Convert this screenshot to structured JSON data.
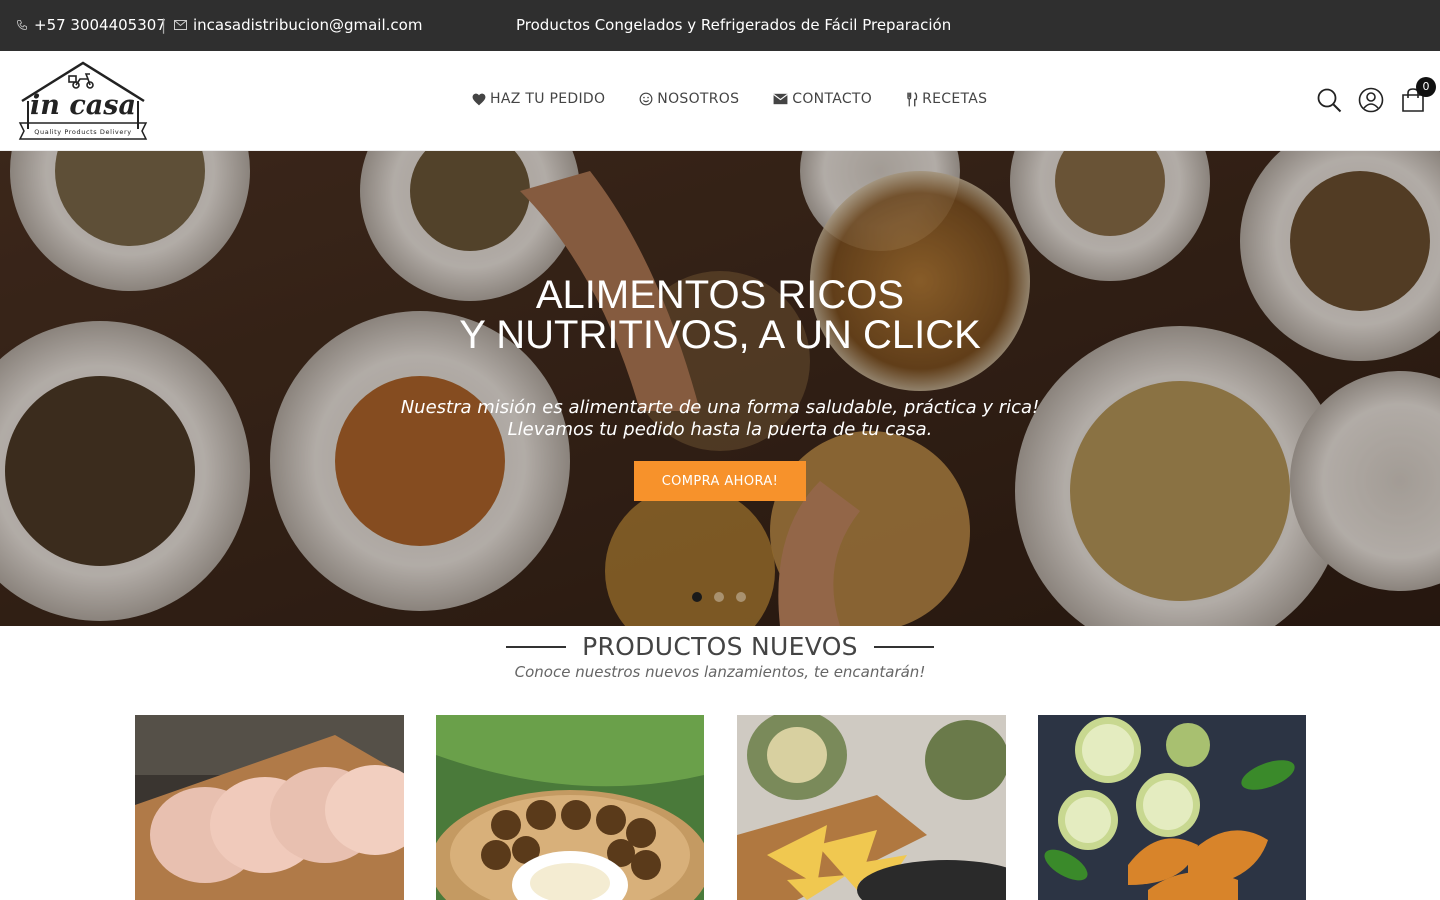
{
  "topbar": {
    "phone": "+57 3004405307",
    "separator": "|",
    "email": "incasadistribucion@gmail.com",
    "tagline": "Productos Congelados y Refrigerados de Fácil Preparación",
    "phone_icon": "phone-icon",
    "email_icon": "envelope-icon"
  },
  "header": {
    "logo": {
      "brand": "in casa",
      "tagline": "Quality Products Delivery"
    },
    "nav": [
      {
        "label": "HAZ TU PEDIDO",
        "icon": "heart-icon"
      },
      {
        "label": "NOSOTROS",
        "icon": "smile-icon"
      },
      {
        "label": "CONTACTO",
        "icon": "envelope-icon"
      },
      {
        "label": "RECETAS",
        "icon": "cutlery-icon"
      }
    ],
    "tools": {
      "search_icon": "search-icon",
      "user_icon": "user-icon",
      "cart_icon": "shopping-bag-icon",
      "cart_count": "0"
    }
  },
  "hero": {
    "title_line1": "ALIMENTOS RICOS",
    "title_line2": "Y NUTRITIVOS, A UN CLICK",
    "subtitle_line1": "Nuestra misión es alimentarte de una forma saludable, práctica y rica!",
    "subtitle_line2": "Llevamos tu pedido hasta la puerta de tu casa.",
    "cta": "COMPRA AHORA!",
    "slides": 3,
    "active_slide": 1
  },
  "section": {
    "title": "PRODUCTOS NUEVOS",
    "subtitle": "Conoce nuestros nuevos lanzamientos, te encantarán!"
  },
  "products": [
    {
      "image": "sliced-ham-photo"
    },
    {
      "image": "falafel-balls-photo"
    },
    {
      "image": "artichoke-nachos-photo"
    },
    {
      "image": "empanadas-lime-photo"
    }
  ],
  "colors": {
    "topbar": "#2f2f2f",
    "accent": "#f7922b",
    "text": "#444444"
  }
}
